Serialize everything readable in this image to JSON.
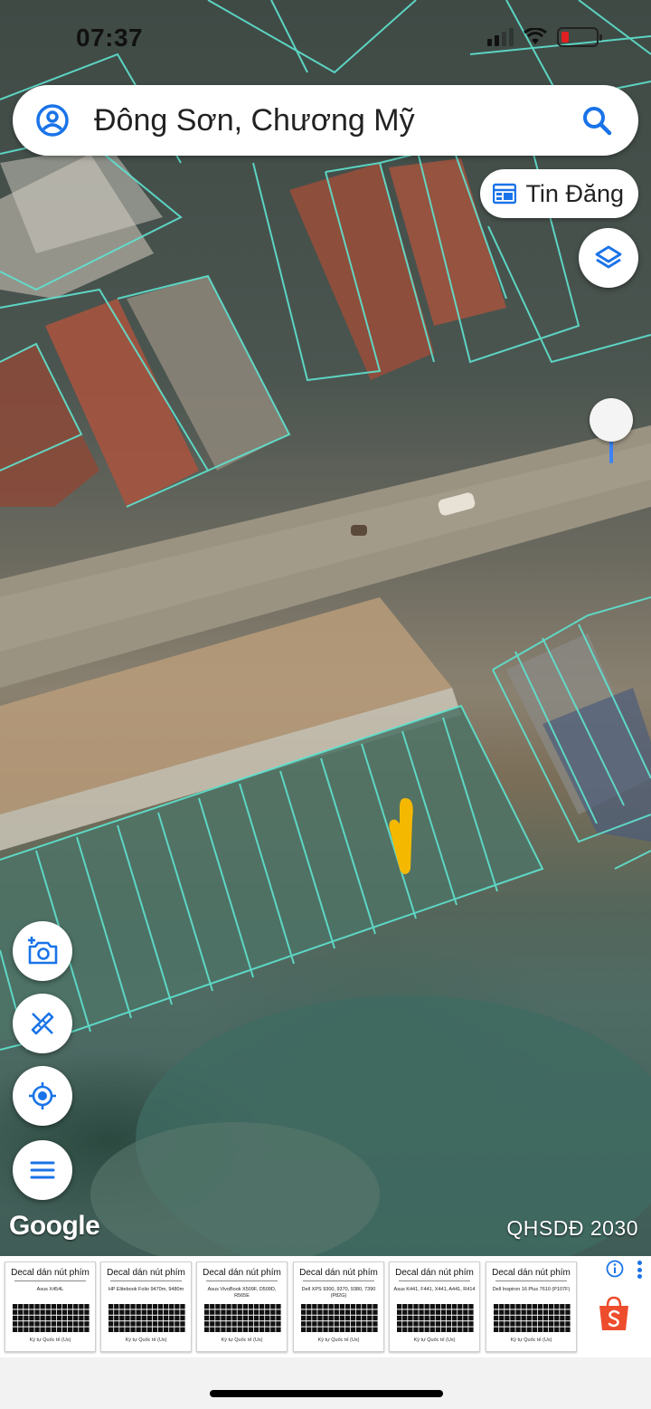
{
  "status_bar": {
    "time": "07:37",
    "battery_level": 0.15
  },
  "search": {
    "query": "Đông Sơn, Chương Mỹ"
  },
  "tin_dang": {
    "label": "Tin Đăng"
  },
  "map": {
    "attribution": "Google",
    "plan_label": "QHSDĐ 2030",
    "parcel_line_color": "#5fe3d0",
    "pin_color": "#f5b800"
  },
  "ads": {
    "cards": [
      {
        "title": "Decal dán nút phím",
        "model": "Asus X454L",
        "footer": "Ký tự Quốc tế (Us)"
      },
      {
        "title": "Decal dán nút phím",
        "model": "HP Elitebook Folio 9470m, 9480m",
        "footer": "Ký tự Quốc tế (Us)"
      },
      {
        "title": "Decal dán nút phím",
        "model": "Asus VivoBook X509F, D509D, R565E",
        "footer": "Ký tự Quốc tế (Us)"
      },
      {
        "title": "Decal dán nút phím",
        "model": "Dell XPS 9300, 9370, 9380, 7390 (P82G)",
        "footer": "Ký tự Quốc tế (Us)"
      },
      {
        "title": "Decal dán nút phím",
        "model": "Asus K441, F441, X441, A441, R414",
        "footer": "Ký tự Quốc tế (Us)"
      },
      {
        "title": "Decal dán nút phím",
        "model": "Dell Inspiron 16 Plus 7610 (P107F)",
        "footer": "Ký tự Quốc tế (Us)"
      }
    ],
    "shopee_color": "#ee4d2d"
  }
}
